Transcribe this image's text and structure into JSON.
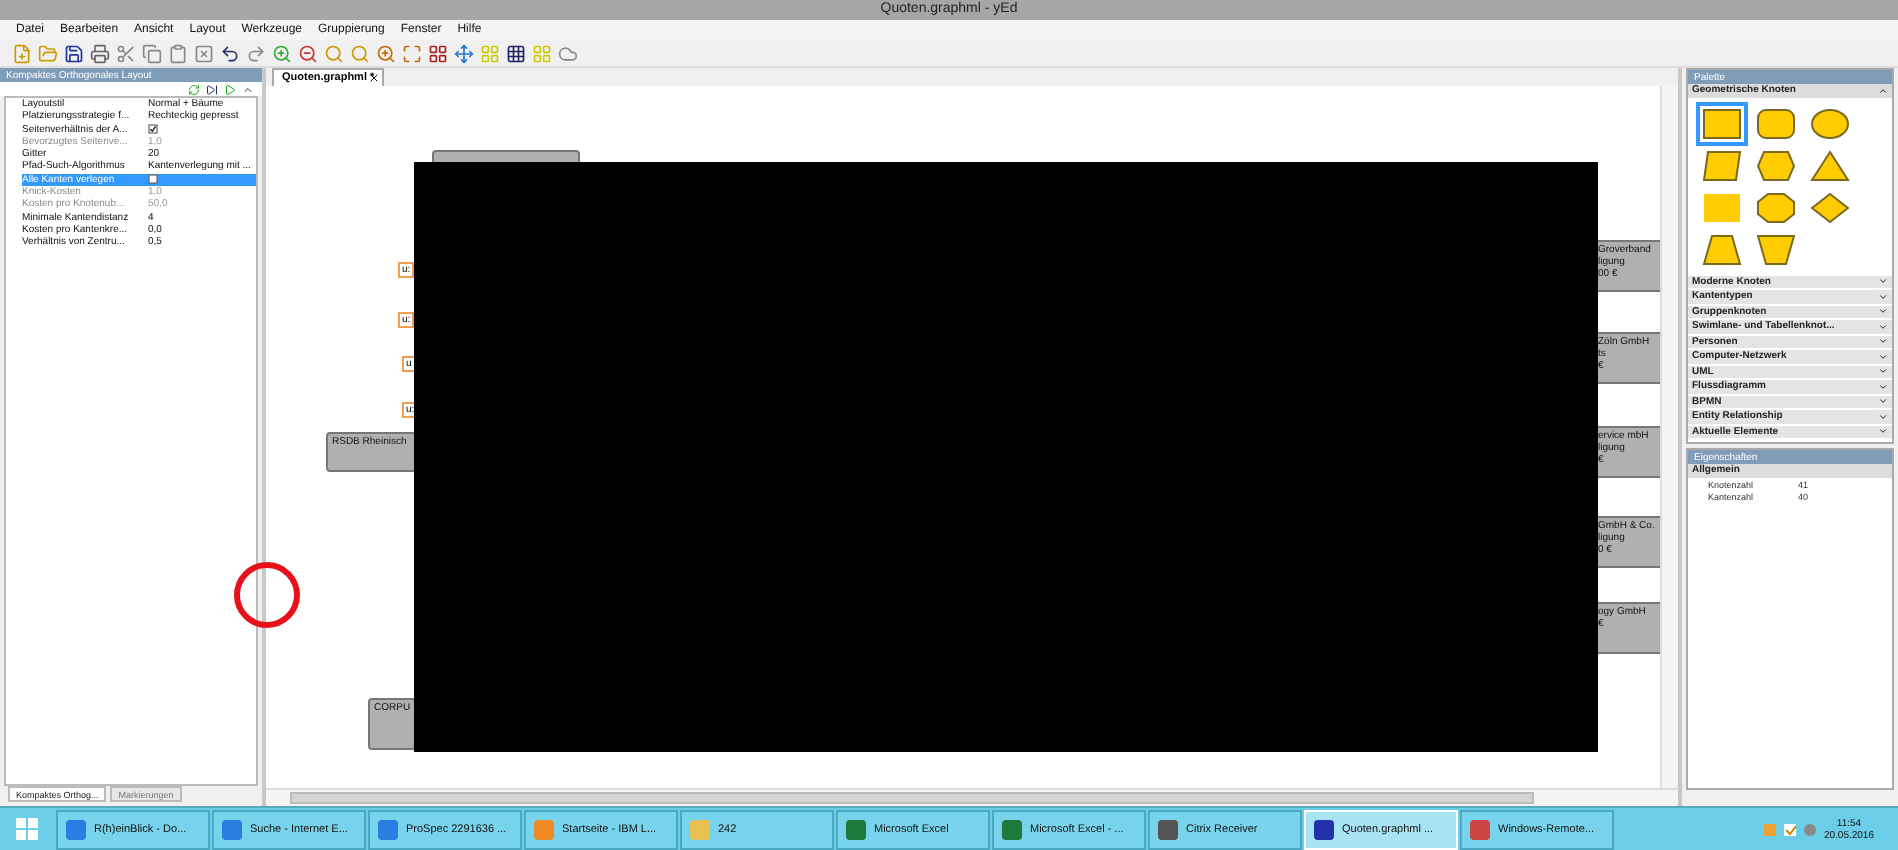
{
  "window": {
    "title": "Quoten.graphml - yEd"
  },
  "menu": [
    "Datei",
    "Bearbeiten",
    "Ansicht",
    "Layout",
    "Werkzeuge",
    "Gruppierung",
    "Fenster",
    "Hilfe"
  ],
  "layout_panel": {
    "title": "Kompaktes Orthogonales Layout",
    "rows": [
      {
        "label": "Layoutstil",
        "kind": "text",
        "value": "Normal + Bäume",
        "selected": false,
        "disabled": false
      },
      {
        "label": "Platzierungsstrategie f...",
        "kind": "text",
        "value": "Rechteckig gepresst",
        "selected": false,
        "disabled": false
      },
      {
        "label": "Seitenverhältnis der A...",
        "kind": "checkbox",
        "checked": true,
        "selected": false,
        "disabled": false
      },
      {
        "label": "Bevorzugtes Seitenve...",
        "kind": "text",
        "value": "1,0",
        "selected": false,
        "disabled": true
      },
      {
        "label": "Gitter",
        "kind": "text",
        "value": "20",
        "selected": false,
        "disabled": false
      },
      {
        "label": "Pfad-Such-Algorithmus",
        "kind": "text",
        "value": "Kantenverlegung mit ...",
        "selected": false,
        "disabled": false
      },
      {
        "label": "Alle Kanten verlegen",
        "kind": "checkbox",
        "checked": false,
        "selected": true,
        "disabled": false
      },
      {
        "label": "Knick-Kosten",
        "kind": "text",
        "value": "1,0",
        "selected": false,
        "disabled": true
      },
      {
        "label": "Kosten pro Knotenub...",
        "kind": "text",
        "value": "50,0",
        "selected": false,
        "disabled": true
      },
      {
        "label": "Minimale Kantendistanz",
        "kind": "text",
        "value": "4",
        "selected": false,
        "disabled": false
      },
      {
        "label": "Kosten pro Kantenkre...",
        "kind": "text",
        "value": "0,0",
        "selected": false,
        "disabled": false
      },
      {
        "label": "Verhältnis von Zentru...",
        "kind": "text",
        "value": "0,5",
        "selected": false,
        "disabled": false
      }
    ]
  },
  "left_tabs": [
    {
      "label": "Kompaktes Orthog...",
      "selected": true
    },
    {
      "label": "Markierungen",
      "selected": false
    }
  ],
  "editor_tabs": [
    {
      "label": "Quoten.graphml *",
      "selected": true
    }
  ],
  "canvas": {
    "labels": [
      "u:",
      "u:",
      "u",
      "u:"
    ],
    "left_nodes": [
      [
        "RSDB Rheinisch"
      ],
      [
        "CORPU"
      ]
    ],
    "right_nodes": [
      [
        "Groverband",
        "ligung",
        "00 €"
      ],
      [
        "Zöln GmbH",
        "ts",
        "€"
      ],
      [
        "ervice mbH",
        "ligung",
        "€"
      ],
      [
        "GmbH & Co.",
        "ligung",
        "0 €"
      ],
      [
        "ogy GmbH",
        "€"
      ]
    ]
  },
  "palette": {
    "title": "Palette",
    "open_section": "Geometrische Knoten",
    "sections": [
      "Moderne Knoten",
      "Kantentypen",
      "Gruppenknoten",
      "Swimlane- und Tabellenknot...",
      "Personen",
      "Computer-Netzwerk",
      "UML",
      "Flussdiagramm",
      "BPMN",
      "Entity Relationship",
      "Aktuelle Elemente"
    ]
  },
  "properties": {
    "title": "Eigenschaften",
    "group": "Allgemein",
    "rows": [
      {
        "label": "Knotenzahl",
        "value": "41"
      },
      {
        "label": "Kantenzahl",
        "value": "40"
      }
    ]
  },
  "taskbar": {
    "items": [
      {
        "label": "R(h)einBlick - Do...",
        "kind": "ie",
        "selected": false
      },
      {
        "label": "Suche - Internet E...",
        "kind": "ie",
        "selected": false
      },
      {
        "label": "ProSpec 2291636 ...",
        "kind": "ie",
        "selected": false
      },
      {
        "label": "Startseite - IBM L...",
        "kind": "notes",
        "selected": false
      },
      {
        "label": "242",
        "kind": "folder",
        "selected": false
      },
      {
        "label": "Microsoft Excel",
        "kind": "excel",
        "selected": false
      },
      {
        "label": "Microsoft Excel - ...",
        "kind": "excel",
        "selected": false
      },
      {
        "label": "Citrix Receiver",
        "kind": "citrix",
        "selected": false
      },
      {
        "label": "Quoten.graphml ...",
        "kind": "yed",
        "selected": true
      },
      {
        "label": "Windows-Remote...",
        "kind": "remote",
        "selected": false
      }
    ],
    "time": "11:54",
    "date": "20.05.2016"
  }
}
